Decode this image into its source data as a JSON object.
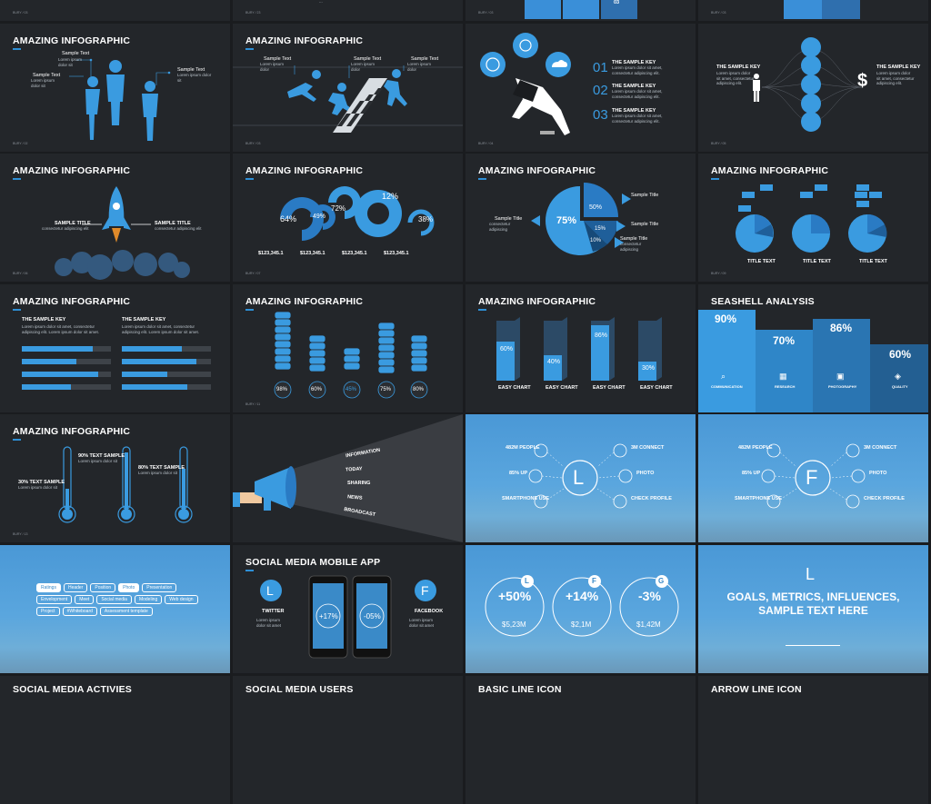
{
  "slides": {
    "r1c1": {
      "foot": "BURY / 03"
    },
    "r1c2": {
      "foot": "BURY / 23"
    },
    "r1c3": {
      "value": "03",
      "foot": "BURY / 03"
    },
    "r1c4": {
      "foot": "BURY / 03"
    },
    "s1": {
      "title": "AMAZING INFOGRAPHIC",
      "l1": "Sample Text",
      "l2": "Sample Text",
      "l3": "Sample Text",
      "foot": "BURY / 02"
    },
    "s2": {
      "title": "AMAZING INFOGRAPHIC",
      "l1": "Sample Text",
      "l2": "Sample Text",
      "l3": "Sample Text",
      "foot": "BURY / 03"
    },
    "s3": {
      "n1": "01",
      "n2": "02",
      "n3": "03",
      "k1": "THE SAMPLE KEY",
      "k2": "THE SAMPLE KEY",
      "k3": "THE SAMPLE KEY",
      "foot": "BURY / 04"
    },
    "s4": {
      "k1": "THE SAMPLE KEY",
      "k2": "THE SAMPLE KEY",
      "foot": "BURY / 05"
    },
    "s5": {
      "title": "AMAZING INFOGRAPHIC",
      "l1": "SAMPLE TITLE",
      "l2": "SAMPLE TITLE",
      "foot": "BURY / 06"
    },
    "s6": {
      "title": "AMAZING INFOGRAPHIC",
      "p1": "64%",
      "p2": "49%",
      "p3": "72%",
      "p4": "12%",
      "p5": "38%",
      "v1": "$123,345.1",
      "v2": "$123,345.1",
      "v3": "$123,345.1",
      "v4": "$123,345.1",
      "foot": "BURY / 07"
    },
    "s7": {
      "title": "AMAZING INFOGRAPHIC",
      "p1": "75%",
      "p2": "50%",
      "p3": "15%",
      "p4": "10%",
      "l1": "Sample Title",
      "l2": "Sample Title",
      "l3": "Sample Title",
      "l4": "Sample Title",
      "foot": "BURY / 08"
    },
    "s8": {
      "title": "AMAZING INFOGRAPHIC",
      "t1": "TITLE TEXT",
      "t2": "TITLE TEXT",
      "t3": "TITLE TEXT",
      "foot": "BURY / 09"
    },
    "s9": {
      "title": "AMAZING INFOGRAPHIC",
      "k1": "THE SAMPLE KEY",
      "k2": "THE SAMPLE KEY",
      "foot": "BURY / 10"
    },
    "s10": {
      "title": "AMAZING INFOGRAPHIC",
      "p1": "98%",
      "p2": "60%",
      "p3": "45%",
      "p4": "75%",
      "p5": "80%",
      "foot": "BURY / 11"
    },
    "s11": {
      "title": "AMAZING INFOGRAPHIC",
      "p1": "60%",
      "p2": "40%",
      "p3": "86%",
      "p4": "30%",
      "c1": "EASY CHART",
      "c2": "EASY CHART",
      "c3": "EASY CHART",
      "c4": "EASY CHART"
    },
    "s12": {
      "title": "SEASHELL ANALYSIS",
      "p1": "90%",
      "p2": "70%",
      "p3": "86%",
      "p4": "60%",
      "c1": "COMMUNICATION",
      "c2": "RESEARCH",
      "c3": "PHOTOGRAPHY",
      "c4": "QUALITY"
    },
    "s13": {
      "title": "AMAZING INFOGRAPHIC",
      "l1": "90% TEXT SAMPLE",
      "l2": "80% TEXT SAMPLE",
      "l3": "30% TEXT SAMPLE",
      "foot": "BURY / 13"
    },
    "s14": {
      "w1": "INFORMATION",
      "w2": "TODAY",
      "w3": "SHARING",
      "w4": "NEWS",
      "w5": "BROADCAST"
    },
    "s15": {
      "letter": "L",
      "a": "482M PEOPLE",
      "b": "85% UP",
      "c": "SMARTPHONE USE",
      "d": "3M CONNECT",
      "e": "PHOTO",
      "f": "CHECK PROFILE"
    },
    "s16": {
      "letter": "F",
      "a": "482M PEOPLE",
      "b": "85% UP",
      "c": "SMARTPHONE USE",
      "d": "3M CONNECT",
      "e": "PHOTO",
      "f": "CHECK PROFILE"
    },
    "s17": {
      "tags": [
        "Ratings",
        "Header",
        "Position",
        "Photo",
        "Presentation",
        "Envelopment",
        "Meet",
        "Social media",
        "Modeling",
        "Web design",
        "Project",
        "#Whiteboard",
        "Assessment template"
      ]
    },
    "s18": {
      "title": "SOCIAL MEDIA MOBILE APP",
      "m1": "+17%",
      "m2": "-05%",
      "l": "L",
      "f": "F",
      "t1": "TWITTER",
      "t2": "FACEBOOK"
    },
    "s19": {
      "c1": "+50%",
      "c2": "+14%",
      "c3": "-3%",
      "v1": "$5,23M",
      "v2": "$2,1M",
      "v3": "$1,42M",
      "i1": "L",
      "i2": "F",
      "i3": "G"
    },
    "s20": {
      "letter": "L",
      "title": "GOALS, METRICS, INFLUENCES, SAMPLE TEXT HERE"
    },
    "b1": {
      "title": "SOCIAL MEDIA ACTIVIES"
    },
    "b2": {
      "title": "SOCIAL MEDIA USERS"
    },
    "b3": {
      "title": "BASIC LINE ICON"
    },
    "b4": {
      "title": "ARROW LINE ICON"
    }
  }
}
